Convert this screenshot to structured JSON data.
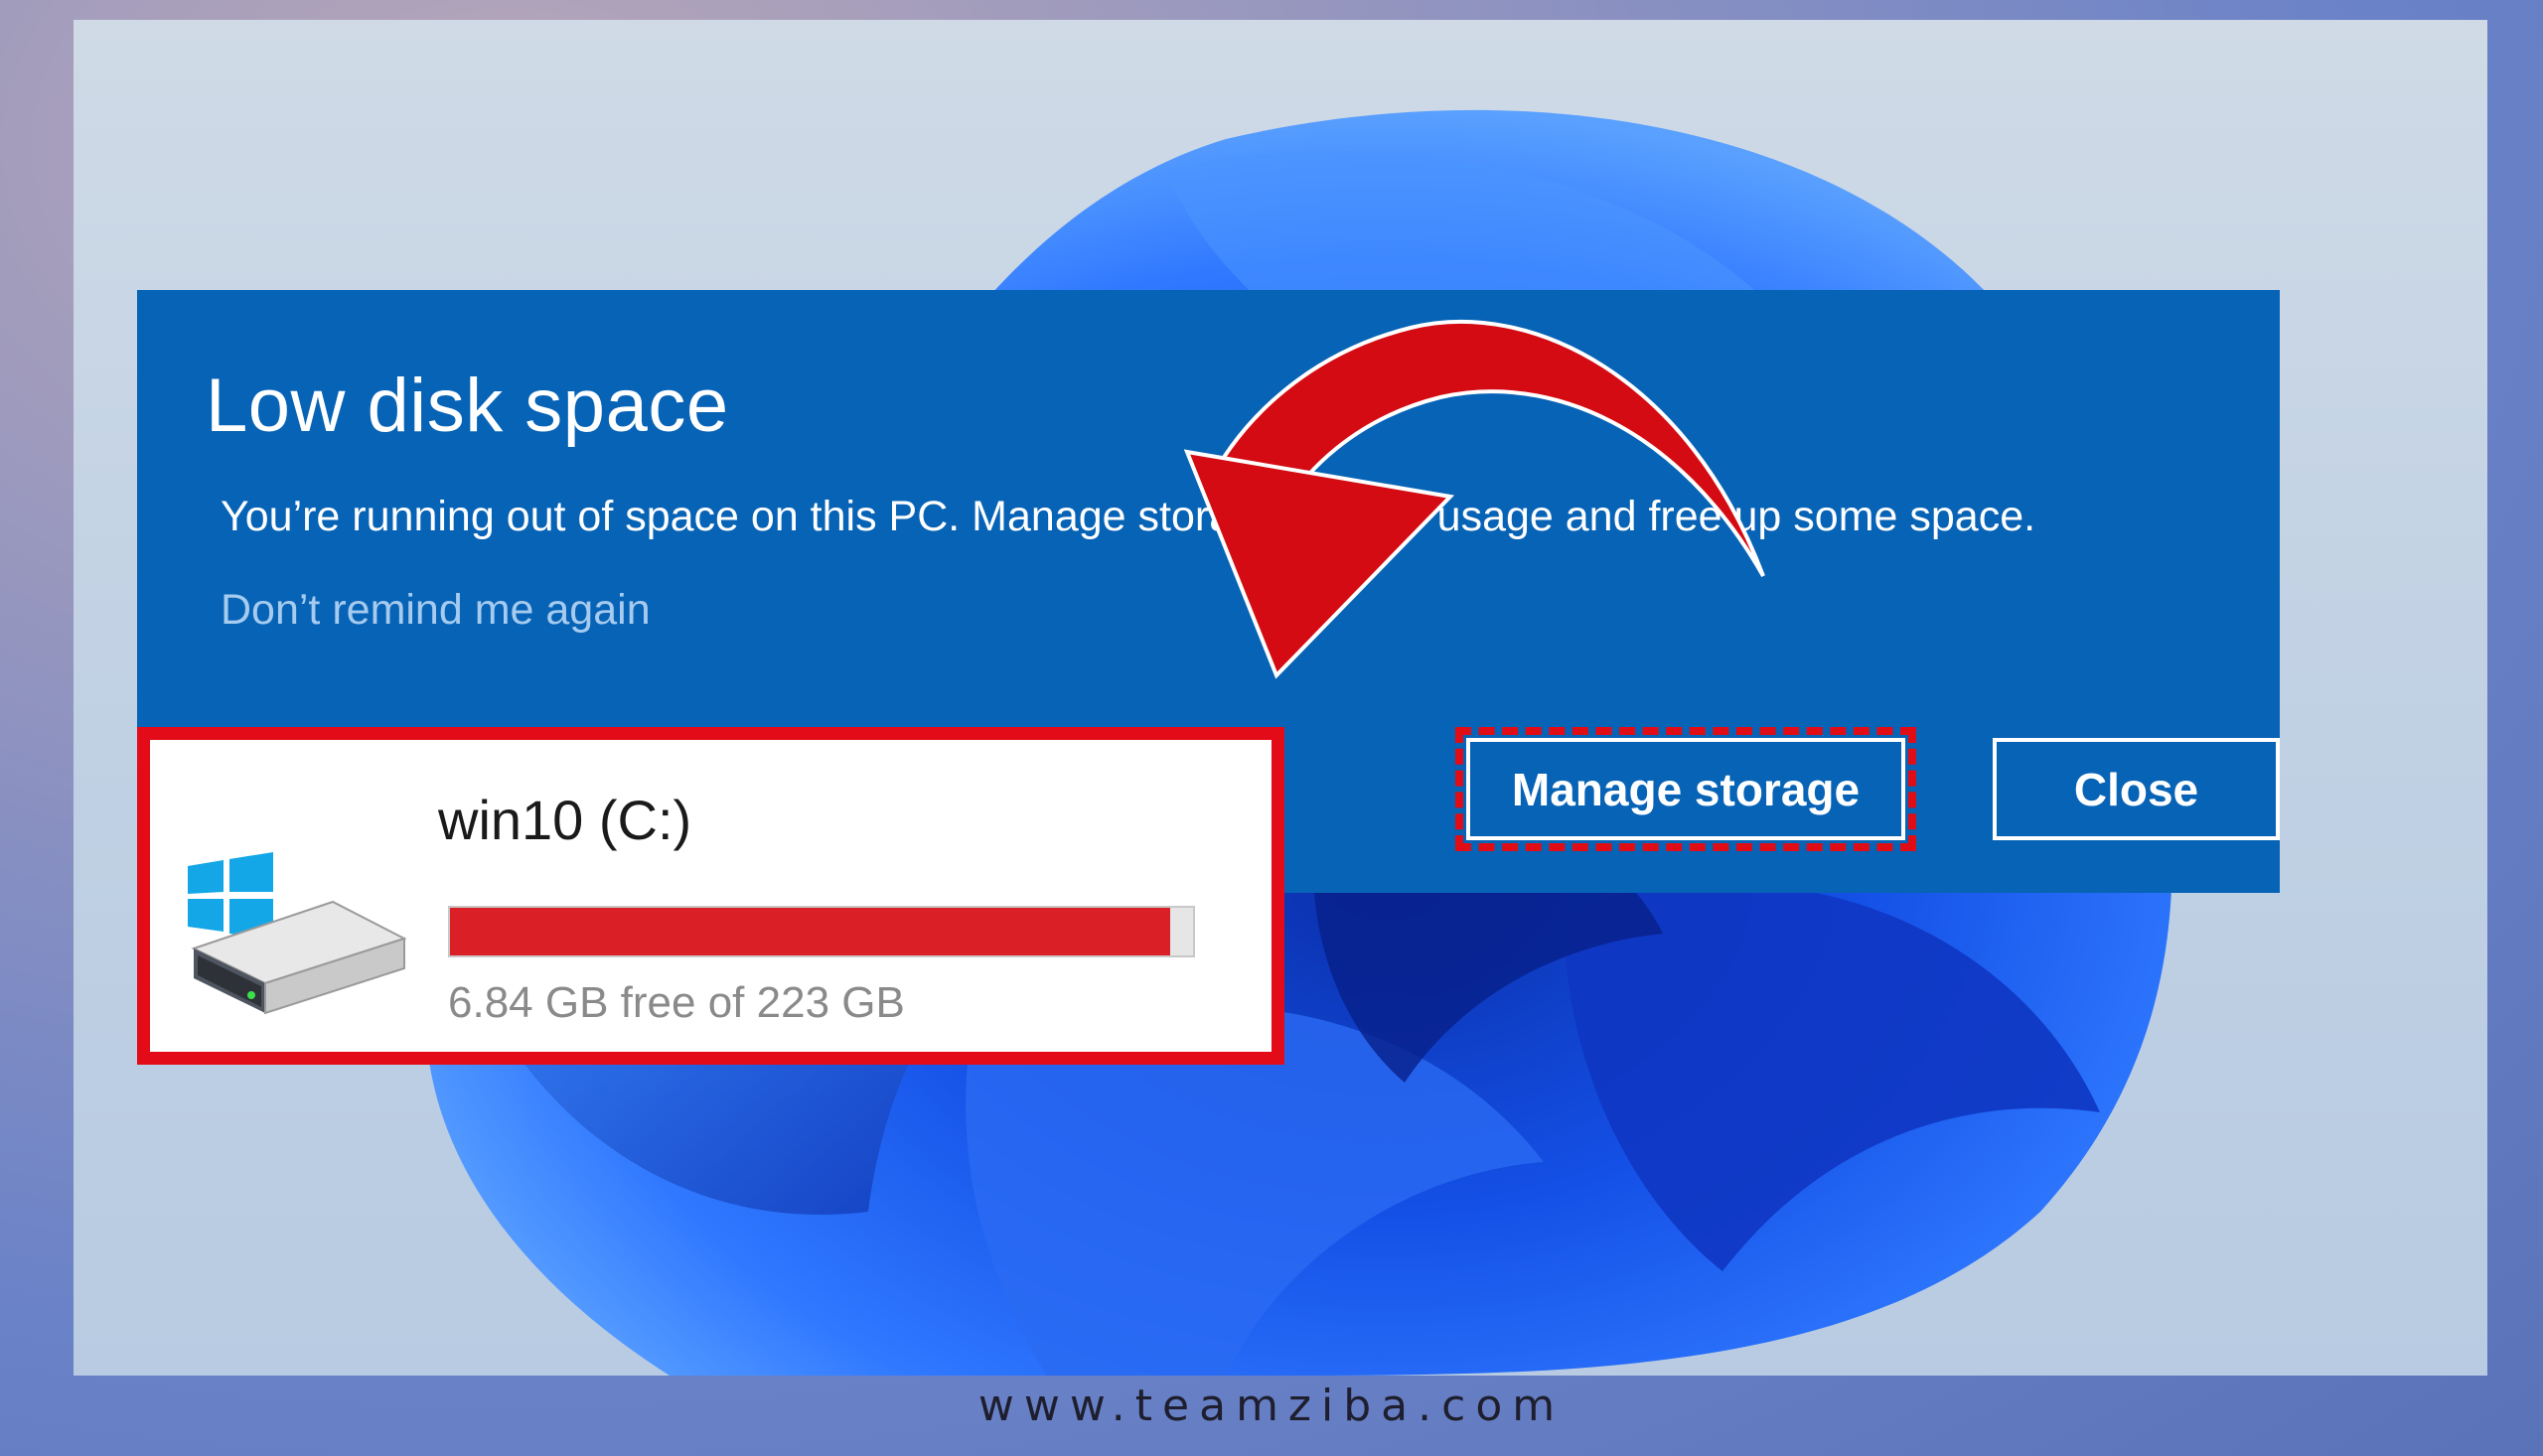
{
  "dialog": {
    "title": "Low disk space",
    "message": "You’re running out of space on this PC. Manage storage to view usage and free up some space.",
    "dont_remind_label": "Don’t remind me again",
    "manage_storage_label": "Manage storage",
    "close_label": "Close"
  },
  "drive": {
    "name": "win10 (C:)",
    "free_text": "6.84 GB free of 223 GB",
    "used_fraction": 0.969,
    "bar_color": "#da1f26"
  },
  "footer": {
    "website": "www.teamziba.com"
  },
  "colors": {
    "dialog_background": "#0763b6",
    "highlight_red": "#e30b17",
    "link_text": "#a6cbef"
  },
  "icons": [
    "windows-logo-icon",
    "hard-drive-icon",
    "curved-arrow-icon"
  ]
}
